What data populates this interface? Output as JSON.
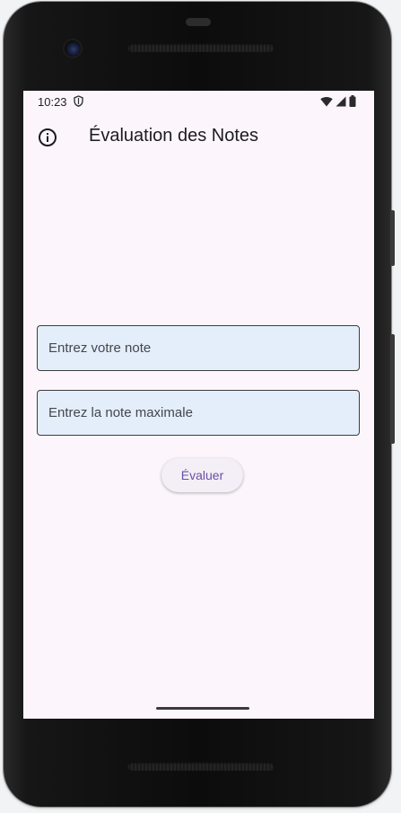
{
  "status_bar": {
    "time": "10:23",
    "icons": [
      "shield-icon",
      "wifi-icon",
      "cellular-icon",
      "battery-icon"
    ]
  },
  "app_bar": {
    "title": "Évaluation des Notes",
    "leading_icon": "info-icon"
  },
  "form": {
    "note_field": {
      "placeholder": "Entrez votre note",
      "value": ""
    },
    "max_field": {
      "placeholder": "Entrez la note maximale",
      "value": ""
    },
    "evaluate_label": "Évaluer"
  },
  "colors": {
    "background": "#fcf6fc",
    "field_fill": "#e3eefa",
    "button_text": "#6750a4"
  }
}
